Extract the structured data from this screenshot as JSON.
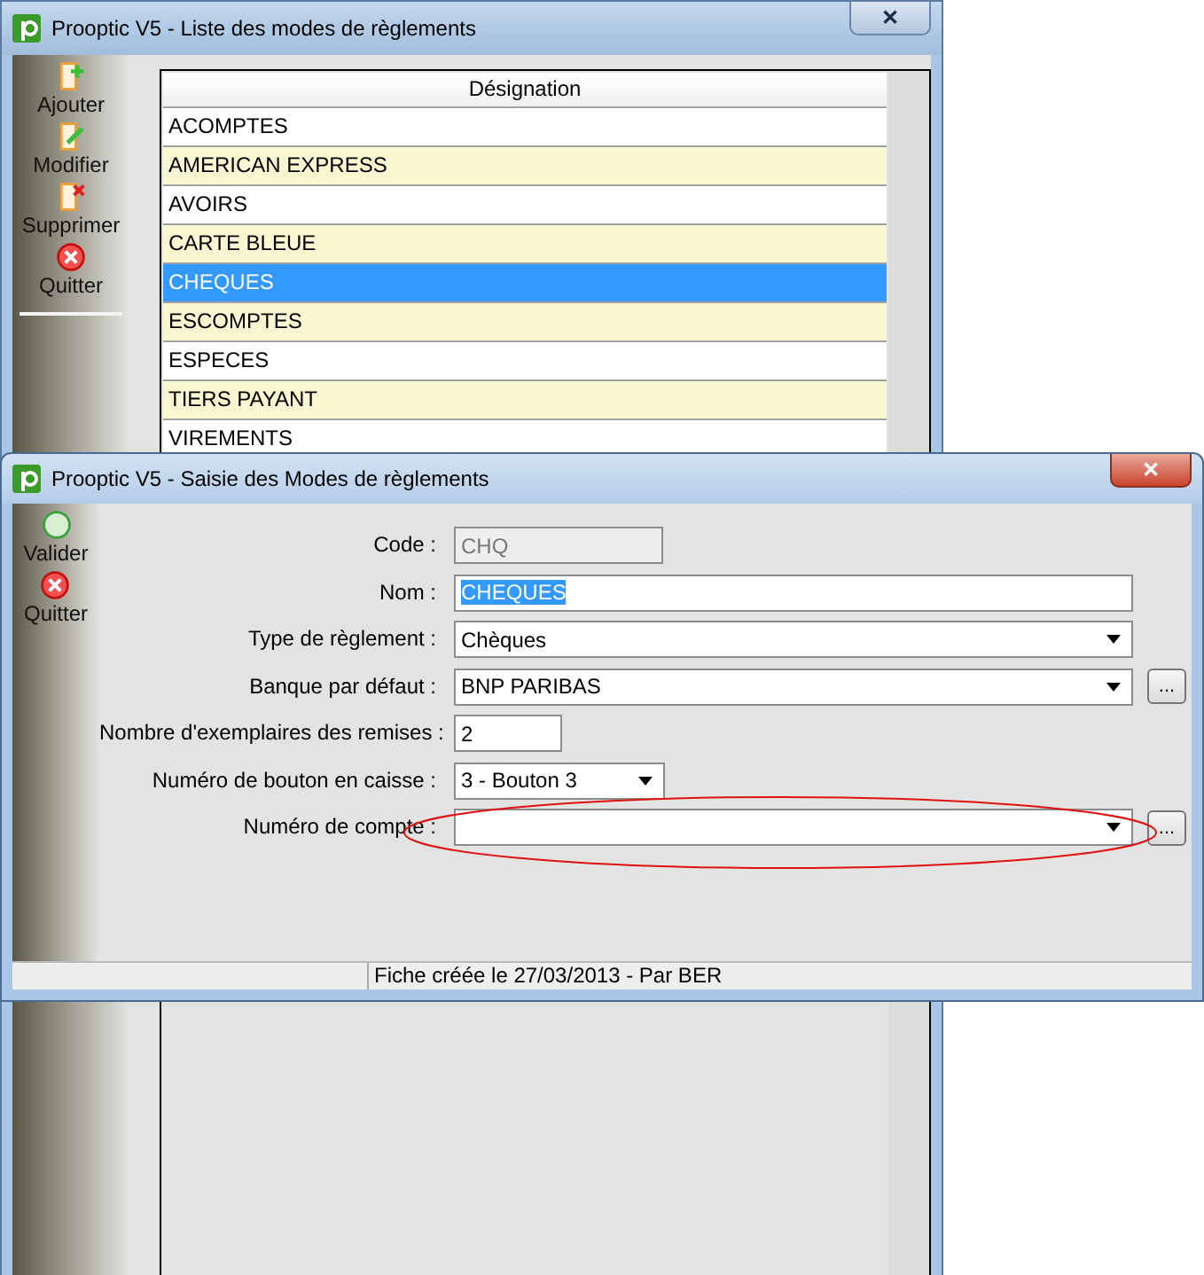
{
  "list_window": {
    "title": "Prooptic V5 - Liste des modes de règlements",
    "active": false,
    "close_label": "✕",
    "actions": [
      {
        "label": "Ajouter",
        "kind": "add"
      },
      {
        "label": "Modifier",
        "kind": "edit"
      },
      {
        "label": "Supprimer",
        "kind": "delete"
      },
      {
        "label": "Quitter",
        "kind": "quit"
      }
    ],
    "table": {
      "columns": [
        "Désignation"
      ],
      "rows": [
        {
          "designation": "ACOMPTES",
          "selected": false
        },
        {
          "designation": "AMERICAN EXPRESS",
          "selected": false
        },
        {
          "designation": "AVOIRS",
          "selected": false
        },
        {
          "designation": "CARTE BLEUE",
          "selected": false
        },
        {
          "designation": "CHEQUES",
          "selected": true
        },
        {
          "designation": "ESCOMPTES",
          "selected": false
        },
        {
          "designation": "ESPECES",
          "selected": false
        },
        {
          "designation": "TIERS PAYANT",
          "selected": false
        },
        {
          "designation": "VIREMENTS",
          "selected": false
        }
      ]
    }
  },
  "form_window": {
    "title": "Prooptic V5 - Saisie des Modes de règlements",
    "active": true,
    "close_label": "✕",
    "actions": [
      {
        "label": "Valider",
        "kind": "validate"
      },
      {
        "label": "Quitter",
        "kind": "quit"
      }
    ],
    "fields": [
      {
        "label": "Code :",
        "kind": "code",
        "value": "CHQ",
        "disabled": true
      },
      {
        "label": "Nom :",
        "kind": "text",
        "value": "CHEQUES",
        "text_selected": true
      },
      {
        "label": "Type de règlement :",
        "kind": "combo",
        "value": "Chèques"
      },
      {
        "label": "Banque par défaut :",
        "kind": "combo",
        "value": "BNP PARIBAS",
        "browse_label": "..."
      },
      {
        "label": "Nombre d'exemplaires des remises :",
        "kind": "number",
        "value": "2"
      },
      {
        "label": "Numéro de bouton en caisse :",
        "kind": "short-combo",
        "value": "3 - Bouton 3"
      },
      {
        "label": "Numéro de compte :",
        "kind": "combo",
        "browse_label": "..."
      }
    ],
    "status": "Fiche créée le 27/03/2013 - Par BER"
  }
}
